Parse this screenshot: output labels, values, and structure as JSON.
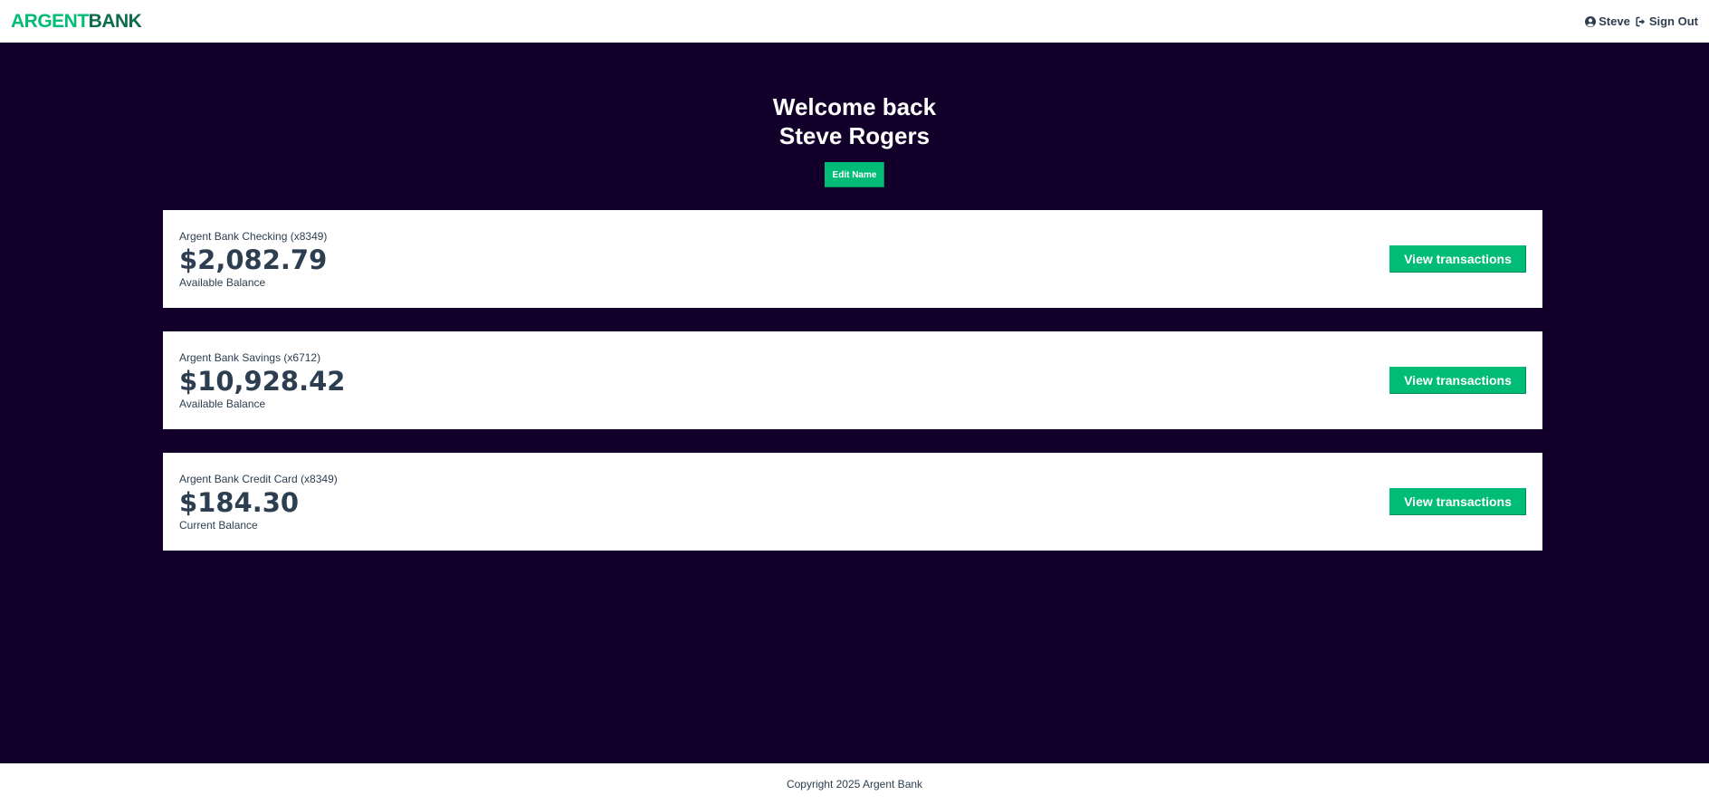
{
  "brand": {
    "part1": "ARGENT",
    "part2": "BANK"
  },
  "nav": {
    "user_label": "Steve",
    "signout_label": "Sign Out"
  },
  "header": {
    "line1": "Welcome back",
    "line2": "Steve Rogers",
    "edit_label": "Edit Name"
  },
  "accounts": [
    {
      "title": "Argent Bank Checking (x8349)",
      "amount": "$2,082.79",
      "description": "Available Balance",
      "button": "View transactions"
    },
    {
      "title": "Argent Bank Savings (x6712)",
      "amount": "$10,928.42",
      "description": "Available Balance",
      "button": "View transactions"
    },
    {
      "title": "Argent Bank Credit Card (x8349)",
      "amount": "$184.30",
      "description": "Current Balance",
      "button": "View transactions"
    }
  ],
  "footer": {
    "text": "Copyright 2025 Argent Bank"
  },
  "colors": {
    "accent": "#00bc77",
    "background": "#12002b",
    "text": "#2c3e50"
  }
}
